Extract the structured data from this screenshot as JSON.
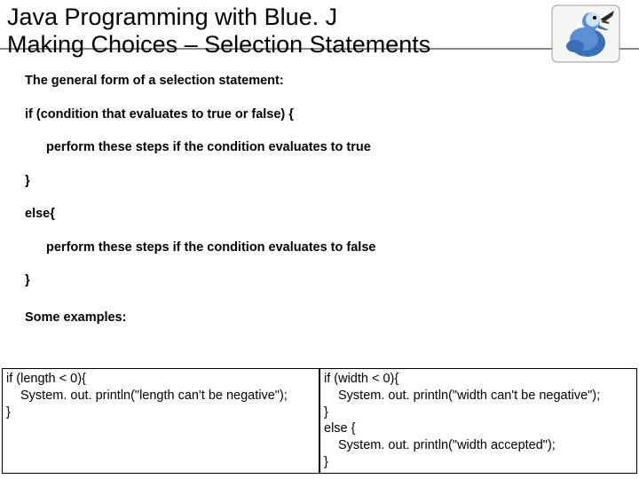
{
  "title": {
    "line1": "Java Programming with Blue. J",
    "line2": "Making Choices – Selection Statements"
  },
  "body": {
    "intro": "The general form of a selection statement:",
    "if_line": "if (condition that evaluates to true or false) {",
    "if_body": "perform these steps if the condition evaluates to true",
    "close1": "}",
    "else_line": "else{",
    "else_body": "perform these steps if the condition evaluates to false",
    "close2": "}",
    "examples_label": "Some examples:"
  },
  "example_left": {
    "l1": "if (length < 0){",
    "l2": "System. out. println(\"length can't be negative\");",
    "l3": "}"
  },
  "example_right": {
    "l1": "if (width < 0){",
    "l2": "System. out. println(\"width can't be negative\");",
    "l3": "}",
    "l4": "else {",
    "l5": "System. out. println(\"width accepted\");",
    "l6": "}"
  }
}
